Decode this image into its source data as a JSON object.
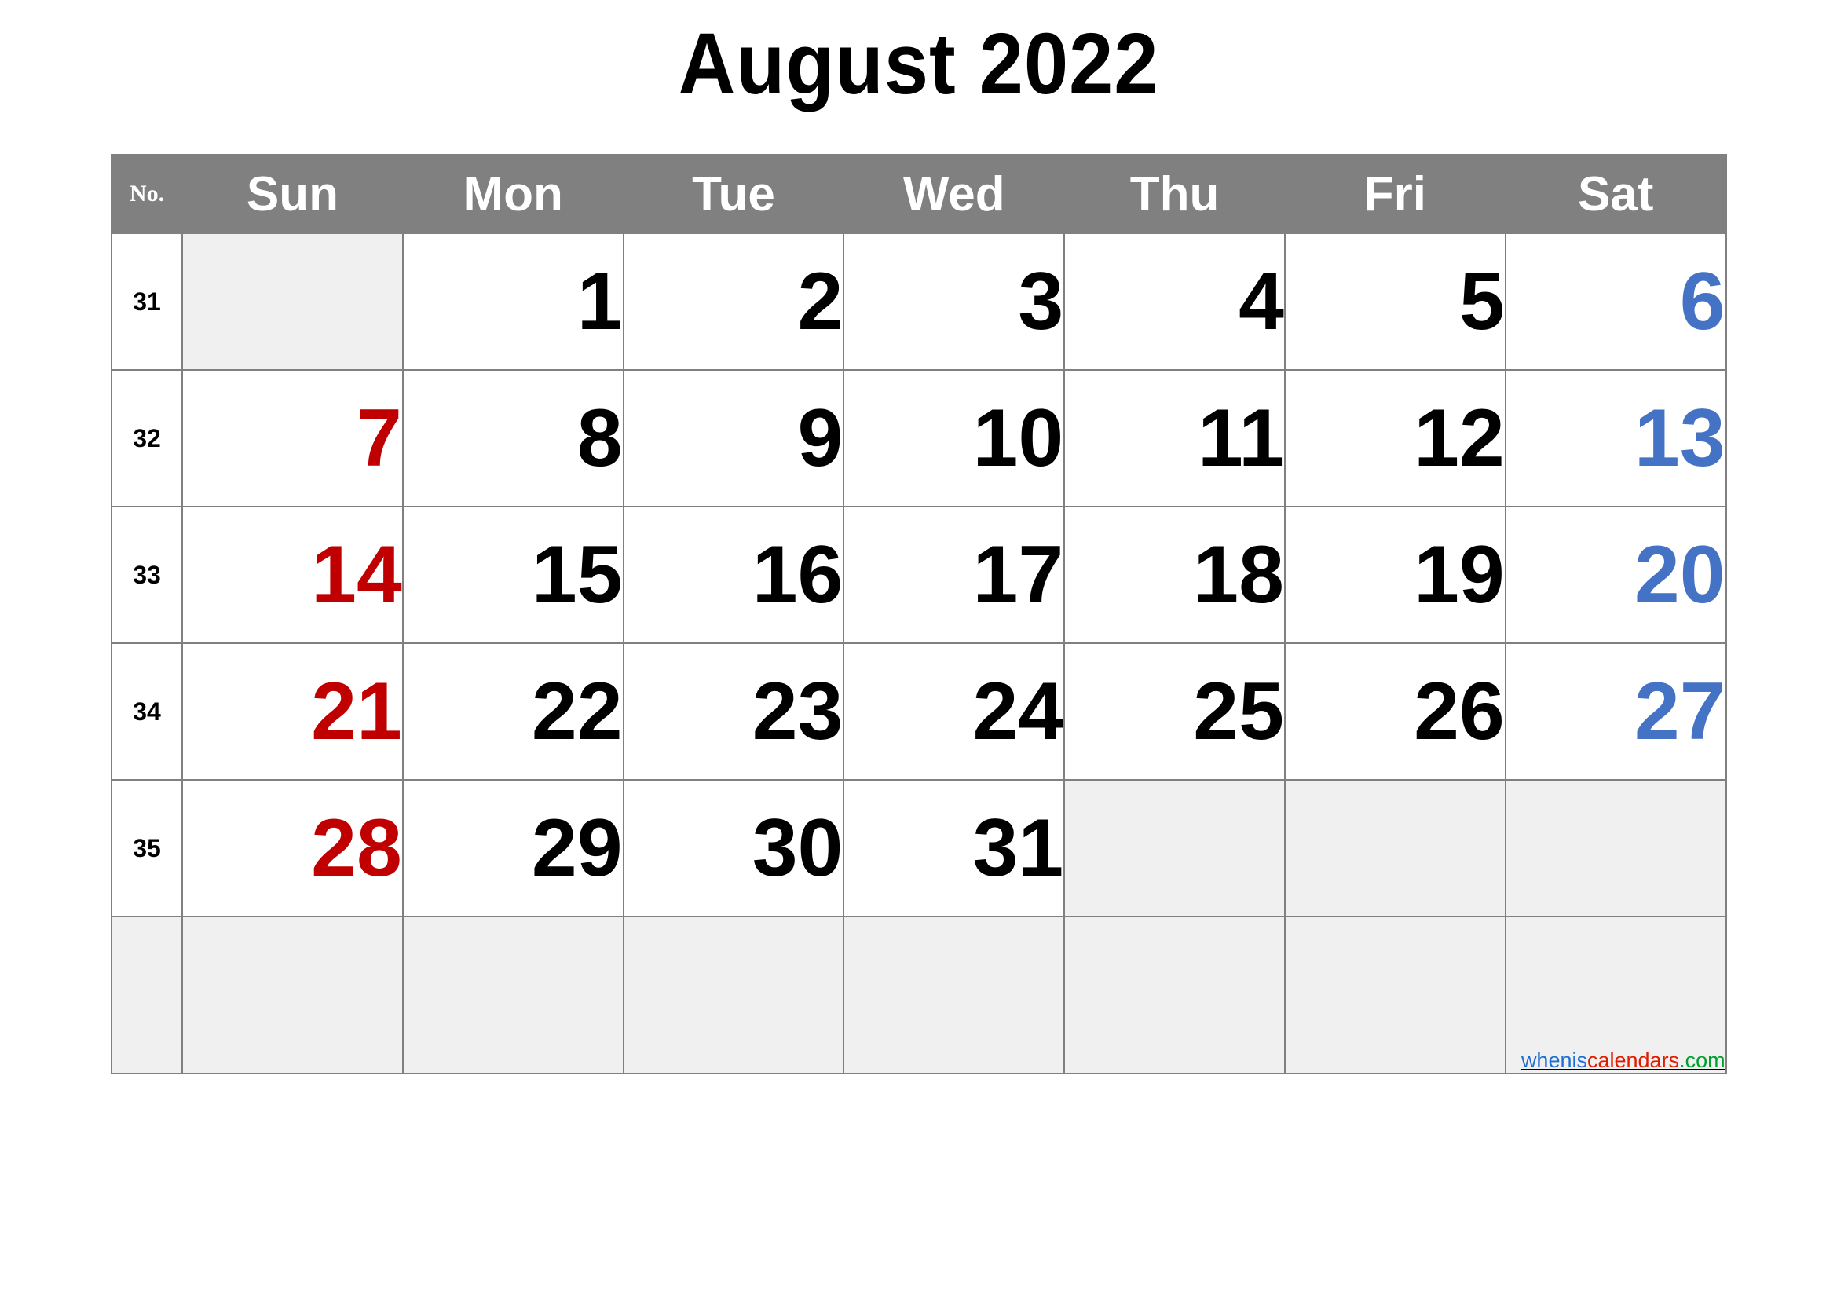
{
  "title": "August 2022",
  "header": {
    "week_no_label": "No.",
    "days": [
      "Sun",
      "Mon",
      "Tue",
      "Wed",
      "Thu",
      "Fri",
      "Sat"
    ]
  },
  "colors": {
    "header_bg": "#808080",
    "header_text": "#ffffff",
    "grid_line": "#808080",
    "empty_cell": "#f0f0f0",
    "sunday": "#c00000",
    "saturday": "#4472c4",
    "weekday": "#000000"
  },
  "weeks": [
    {
      "number": "31",
      "days": [
        {
          "label": "",
          "kind": "empty"
        },
        {
          "label": "1",
          "kind": "weekday"
        },
        {
          "label": "2",
          "kind": "weekday"
        },
        {
          "label": "3",
          "kind": "weekday"
        },
        {
          "label": "4",
          "kind": "weekday"
        },
        {
          "label": "5",
          "kind": "weekday"
        },
        {
          "label": "6",
          "kind": "sat"
        }
      ]
    },
    {
      "number": "32",
      "days": [
        {
          "label": "7",
          "kind": "sun"
        },
        {
          "label": "8",
          "kind": "weekday"
        },
        {
          "label": "9",
          "kind": "weekday"
        },
        {
          "label": "10",
          "kind": "weekday"
        },
        {
          "label": "11",
          "kind": "weekday"
        },
        {
          "label": "12",
          "kind": "weekday"
        },
        {
          "label": "13",
          "kind": "sat"
        }
      ]
    },
    {
      "number": "33",
      "days": [
        {
          "label": "14",
          "kind": "sun"
        },
        {
          "label": "15",
          "kind": "weekday"
        },
        {
          "label": "16",
          "kind": "weekday"
        },
        {
          "label": "17",
          "kind": "weekday"
        },
        {
          "label": "18",
          "kind": "weekday"
        },
        {
          "label": "19",
          "kind": "weekday"
        },
        {
          "label": "20",
          "kind": "sat"
        }
      ]
    },
    {
      "number": "34",
      "days": [
        {
          "label": "21",
          "kind": "sun"
        },
        {
          "label": "22",
          "kind": "weekday"
        },
        {
          "label": "23",
          "kind": "weekday"
        },
        {
          "label": "24",
          "kind": "weekday"
        },
        {
          "label": "25",
          "kind": "weekday"
        },
        {
          "label": "26",
          "kind": "weekday"
        },
        {
          "label": "27",
          "kind": "sat"
        }
      ]
    },
    {
      "number": "35",
      "days": [
        {
          "label": "28",
          "kind": "sun"
        },
        {
          "label": "29",
          "kind": "weekday"
        },
        {
          "label": "30",
          "kind": "weekday"
        },
        {
          "label": "31",
          "kind": "weekday"
        },
        {
          "label": "",
          "kind": "empty"
        },
        {
          "label": "",
          "kind": "empty"
        },
        {
          "label": "",
          "kind": "empty"
        }
      ]
    }
  ],
  "watermark": {
    "part1": "whenis",
    "part2": "calendars",
    "part3": ".com"
  }
}
